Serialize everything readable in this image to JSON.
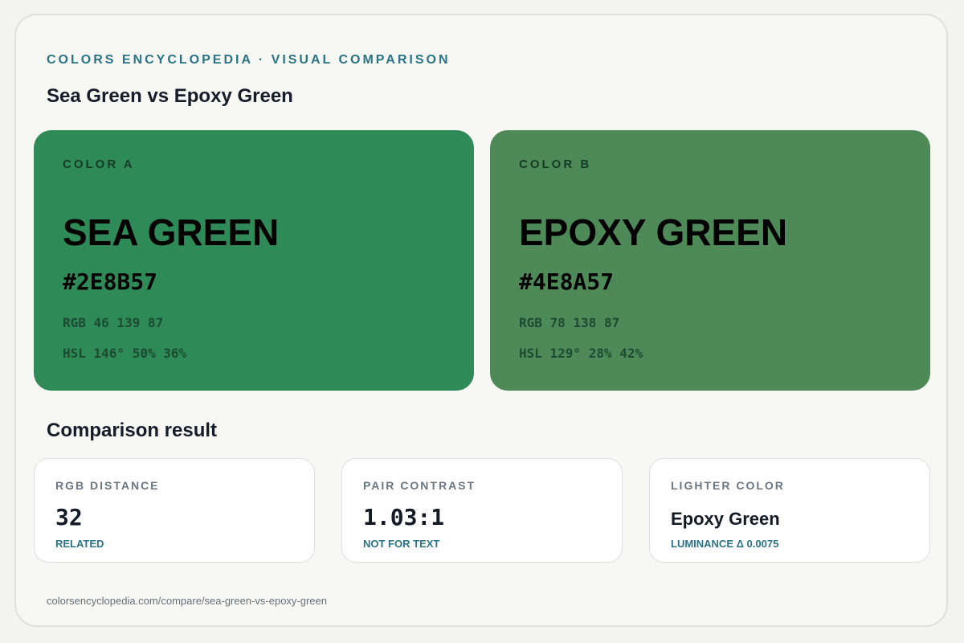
{
  "header": {
    "eyebrow": "COLORS ENCYCLOPEDIA · VISUAL COMPARISON",
    "title": "Sea Green vs Epoxy Green"
  },
  "colors": [
    {
      "tag": "COLOR A",
      "name": "SEA GREEN",
      "hex": "#2E8B57",
      "rgb": "RGB 46 139 87",
      "hsl": "HSL 146° 50% 36%",
      "swatch_color": "#2e8b57"
    },
    {
      "tag": "COLOR B",
      "name": "EPOXY GREEN",
      "hex": "#4E8A57",
      "rgb": "RGB 78 138 87",
      "hsl": "HSL 129° 28% 42%",
      "swatch_color": "#4e8a57"
    }
  ],
  "comparison": {
    "title": "Comparison result",
    "metrics": [
      {
        "label": "RGB DISTANCE",
        "value": "32",
        "note": "RELATED"
      },
      {
        "label": "PAIR CONTRAST",
        "value": "1.03:1",
        "note": "NOT FOR TEXT"
      },
      {
        "label": "LIGHTER COLOR",
        "value": "Epoxy Green",
        "note": "LUMINANCE Δ 0.0075"
      }
    ]
  },
  "footer": {
    "url": "colorsencyclopedia.com/compare/sea-green-vs-epoxy-green"
  }
}
